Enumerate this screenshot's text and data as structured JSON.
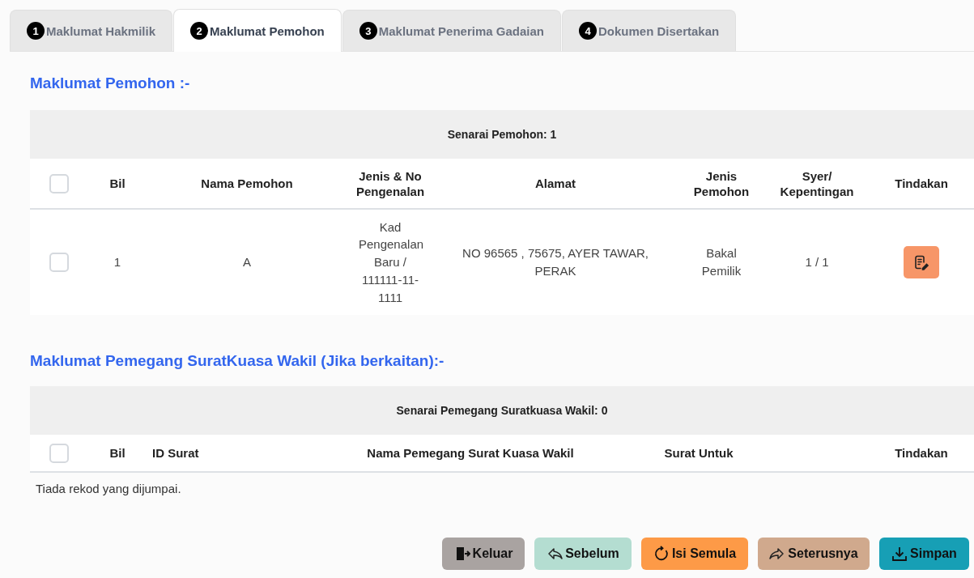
{
  "tabs": [
    {
      "number": "1",
      "label": "Maklumat Hakmilik",
      "selected": false
    },
    {
      "number": "2",
      "label": "Maklumat Pemohon",
      "selected": true
    },
    {
      "number": "3",
      "label": "Maklumat Penerima Gadaian",
      "selected": false
    },
    {
      "number": "4",
      "label": "Dokumen Disertakan",
      "selected": false
    }
  ],
  "sections": [
    {
      "title": "Maklumat Pemohon :-",
      "table": {
        "caption": "Senarai Pemohon: 1",
        "select_all_checked": false,
        "columns": [
          "Bil",
          "Nama Pemohon",
          "Jenis & No Pengenalan",
          "Alamat",
          "Jenis Pemohon",
          "Syer/ Kepentingan",
          "Tindakan"
        ],
        "rows": [
          {
            "checked": false,
            "cells": [
              "1",
              "A",
              "Kad Pengenalan Baru / 111111-11-1111",
              "NO 96565 , 75675, AYER TAWAR, PERAK",
              "Bakal Pemilik",
              "1 / 1"
            ],
            "action": {
              "kind": "edit"
            }
          }
        ]
      }
    },
    {
      "title": "Maklumat Pemegang SuratKuasa Wakil (Jika berkaitan):-",
      "table": {
        "caption": "Senarai Pemegang Suratkuasa Wakil: 0",
        "select_all_checked": false,
        "columns": [
          "Bil",
          "ID Surat",
          "Nama Pemegang Surat Kuasa Wakil",
          "Surat Untuk",
          "Tindakan"
        ],
        "empty_message": "Tiada rekod yang dijumpai."
      }
    }
  ],
  "buttons": [
    {
      "label": "Keluar",
      "kind": "exit"
    },
    {
      "label": "Sebelum",
      "kind": "back"
    },
    {
      "label": "Isi Semula",
      "kind": "reset"
    },
    {
      "label": "Seterusnya",
      "kind": "next"
    },
    {
      "label": "Simpan",
      "kind": "save"
    }
  ]
}
